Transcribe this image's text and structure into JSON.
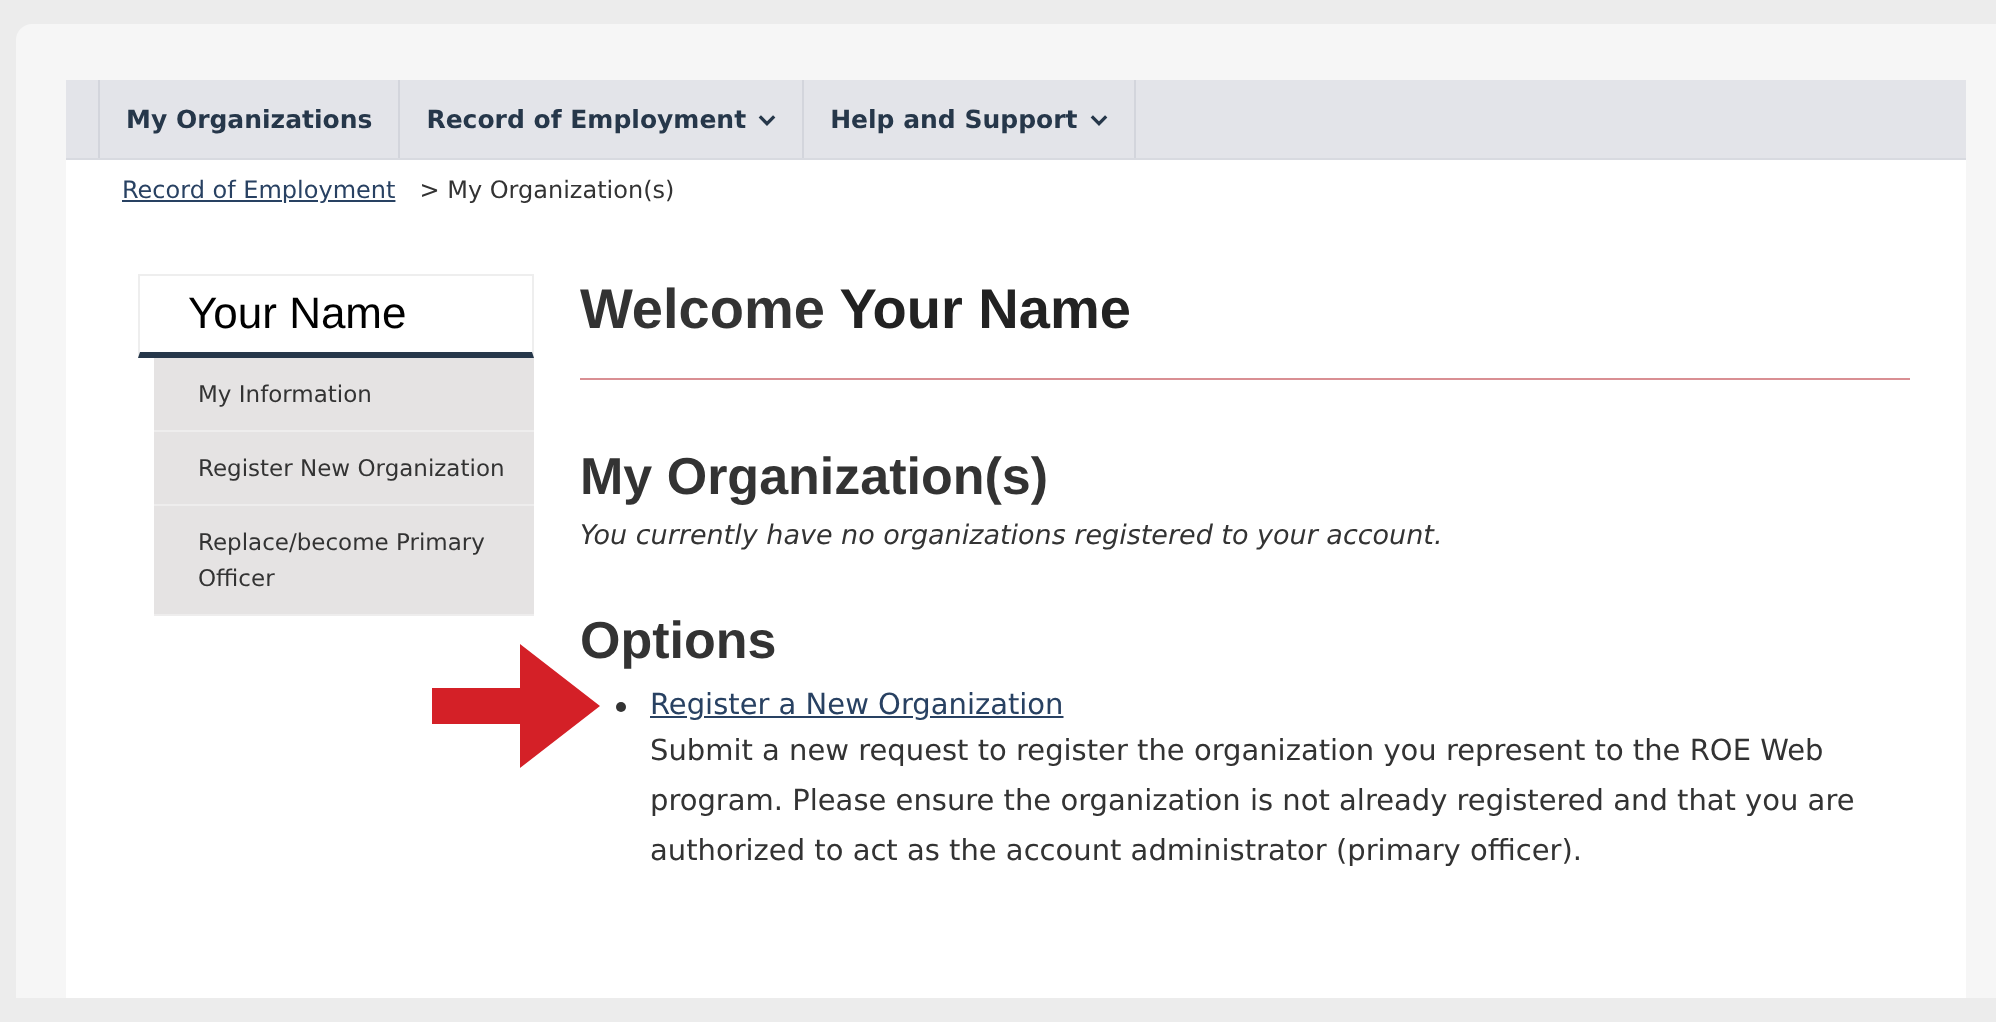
{
  "nav": [
    {
      "label": "My Organizations",
      "dropdown": false
    },
    {
      "label": "Record of Employment",
      "dropdown": true
    },
    {
      "label": "Help and Support",
      "dropdown": true
    }
  ],
  "breadcrumb": {
    "link": "Record of Employment",
    "current": "> My Organization(s)"
  },
  "sidebar": {
    "title": "Your Name",
    "items": [
      "My Information",
      "Register New Organization",
      "Replace/become Primary Officer"
    ]
  },
  "welcome": {
    "prefix": "Welcome",
    "name": "Your Name"
  },
  "organizations": {
    "heading": "My Organization(s)",
    "message": "You currently have no organizations registered to your account."
  },
  "options": {
    "heading": "Options",
    "items": [
      {
        "link": "Register a New Organization",
        "description": "Submit a new request to register the organization you represent to the ROE Web program. Please ensure the organization is not already registered and that you are authorized to act as the account administrator (primary officer)."
      }
    ]
  }
}
